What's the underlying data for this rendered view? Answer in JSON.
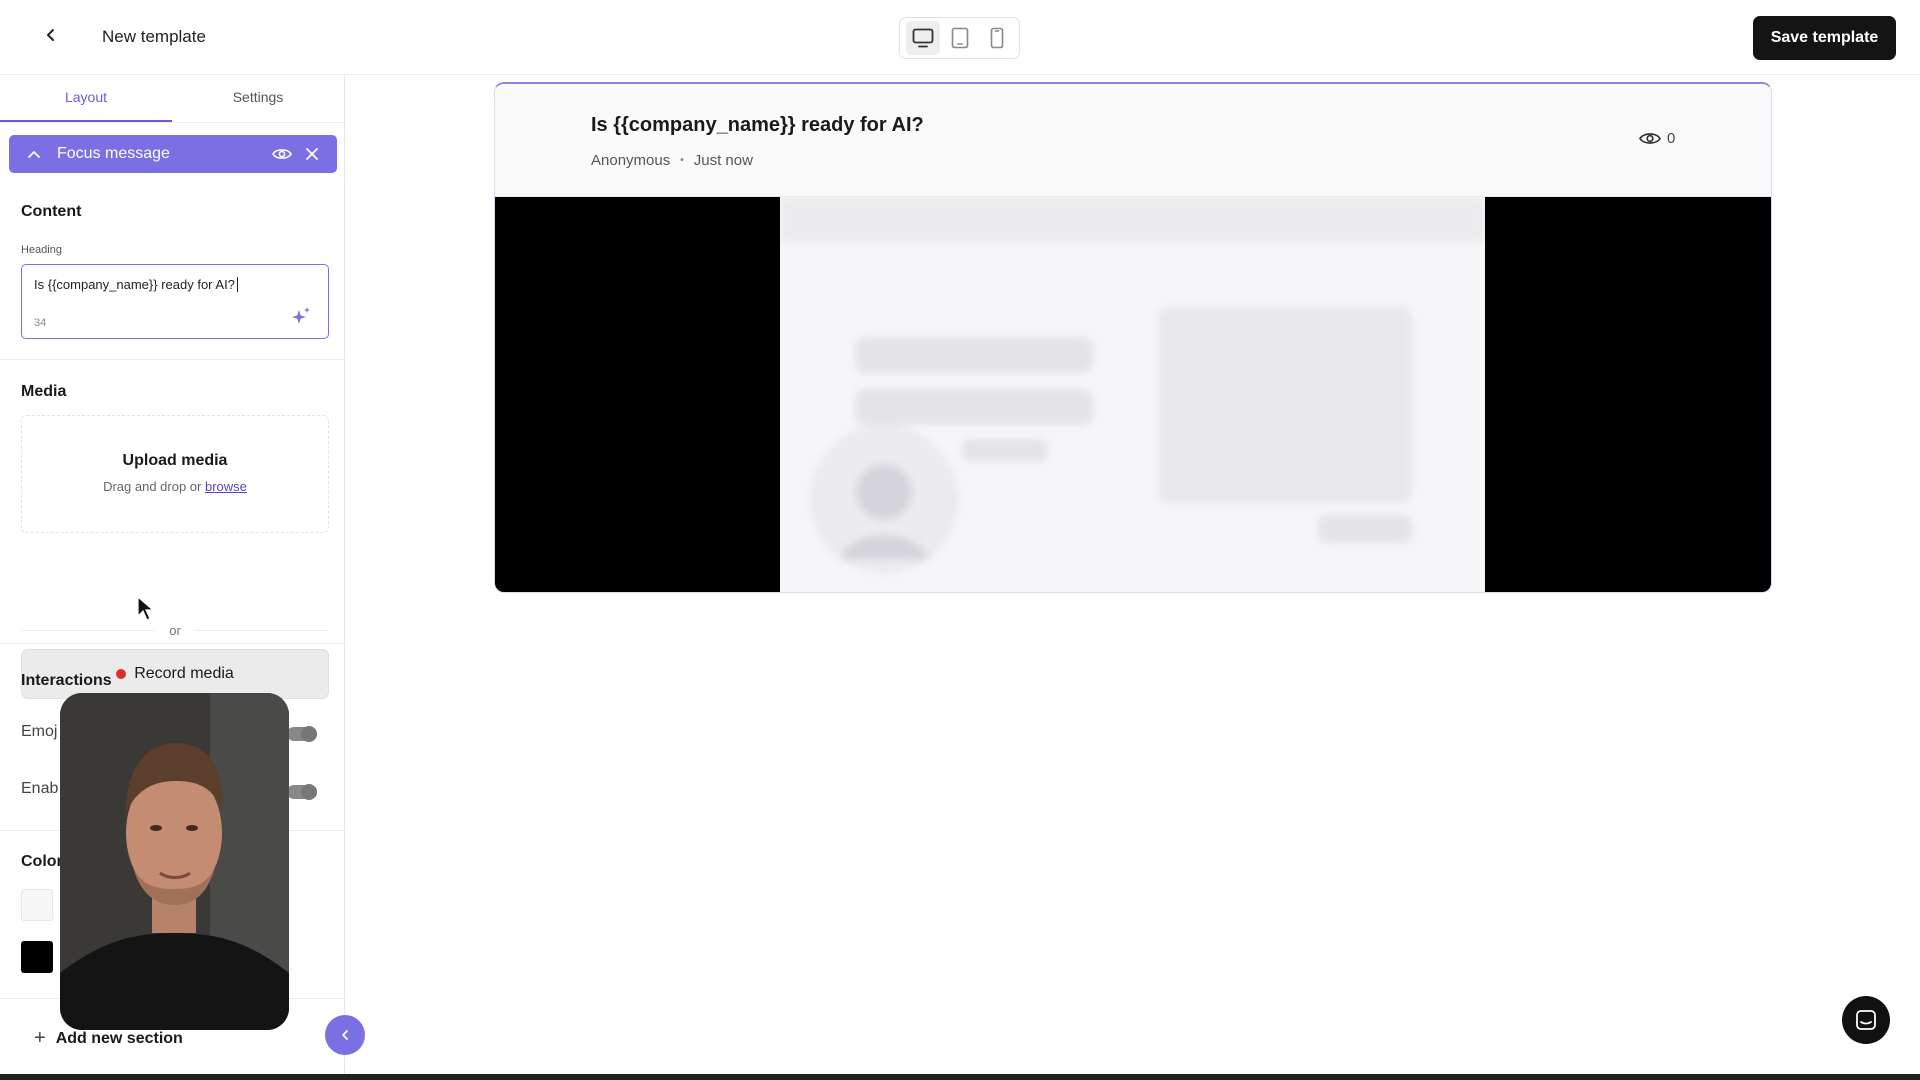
{
  "header": {
    "title": "New template",
    "save_label": "Save template",
    "devices": [
      "desktop-icon",
      "tablet-icon",
      "mobile-icon"
    ]
  },
  "sidebar": {
    "tabs": [
      {
        "label": "Layout",
        "active": true
      },
      {
        "label": "Settings",
        "active": false
      }
    ],
    "focus_section": {
      "label": "Focus message"
    },
    "content": {
      "title": "Content",
      "heading_label": "Heading",
      "heading_value": "Is {{company_name}} ready for AI?",
      "char_count": "34"
    },
    "media": {
      "title": "Media",
      "upload_title": "Upload media",
      "upload_sub": "Drag and drop or",
      "browse_link": "browse",
      "or_text": "or",
      "record_label": "Record media"
    },
    "interactions": {
      "title": "Interactions",
      "items": [
        {
          "label": "Emoj"
        },
        {
          "label": "Enab"
        }
      ]
    },
    "colors": {
      "title": "Color",
      "swatches": [
        "#f7f7f7",
        "#000000"
      ]
    },
    "add_section_label": "Add new section"
  },
  "preview": {
    "title": "Is {{company_name}} ready for AI?",
    "author": "Anonymous",
    "time": "Just now",
    "view_count": "0"
  },
  "colors": {
    "accent": "#7b6fe4",
    "primary_button": "#141414",
    "record_dot": "#d9302f"
  }
}
